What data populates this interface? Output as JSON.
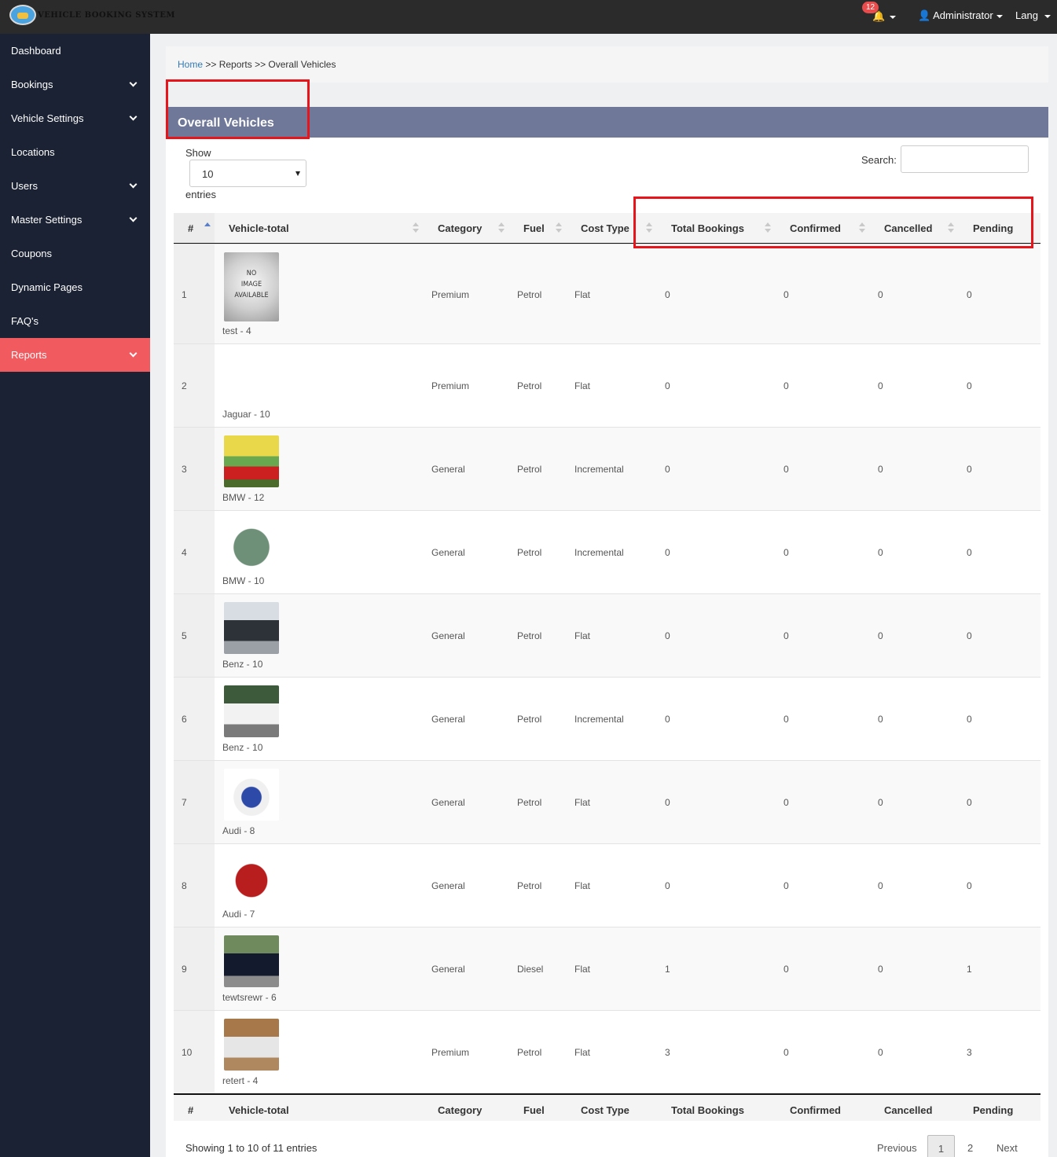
{
  "header": {
    "logo_text": "VEHICLE BOOKING SYSTEM",
    "notification_count": "12",
    "user_label": "Administrator",
    "lang_label": "Lang"
  },
  "sidebar": {
    "items": [
      {
        "label": "Dashboard",
        "has_submenu": false,
        "active": false
      },
      {
        "label": "Bookings",
        "has_submenu": true,
        "active": false
      },
      {
        "label": "Vehicle Settings",
        "has_submenu": true,
        "active": false
      },
      {
        "label": "Locations",
        "has_submenu": false,
        "active": false
      },
      {
        "label": "Users",
        "has_submenu": true,
        "active": false
      },
      {
        "label": "Master Settings",
        "has_submenu": true,
        "active": false
      },
      {
        "label": "Coupons",
        "has_submenu": false,
        "active": false
      },
      {
        "label": "Dynamic Pages",
        "has_submenu": false,
        "active": false
      },
      {
        "label": "FAQ's",
        "has_submenu": false,
        "active": false
      },
      {
        "label": "Reports",
        "has_submenu": true,
        "active": true
      }
    ]
  },
  "breadcrumb": {
    "home": "Home",
    "sep": " >> ",
    "section": "Reports",
    "current": "Overall Vehicles"
  },
  "panel": {
    "title": "Overall Vehicles"
  },
  "controls": {
    "show_label": "Show",
    "page_size": "10",
    "entries_label": "entries",
    "search_label": "Search:",
    "search_value": ""
  },
  "table": {
    "columns": [
      "#",
      "Vehicle-total",
      "Category",
      "Fuel",
      "Cost Type",
      "Total Bookings",
      "Confirmed",
      "Cancelled",
      "Pending"
    ],
    "rows": [
      {
        "n": "1",
        "vehicle": "test - 4",
        "image": "no-image",
        "category": "Premium",
        "fuel": "Petrol",
        "cost_type": "Flat",
        "total": "0",
        "confirmed": "0",
        "cancelled": "0",
        "pending": "0"
      },
      {
        "n": "2",
        "vehicle": "Jaguar - 10",
        "image": "vintage-black-car",
        "category": "Premium",
        "fuel": "Petrol",
        "cost_type": "Flat",
        "total": "0",
        "confirmed": "0",
        "cancelled": "0",
        "pending": "0"
      },
      {
        "n": "3",
        "vehicle": "BMW - 12",
        "image": "red-mini-car",
        "category": "General",
        "fuel": "Petrol",
        "cost_type": "Incremental",
        "total": "0",
        "confirmed": "0",
        "cancelled": "0",
        "pending": "0"
      },
      {
        "n": "4",
        "vehicle": "BMW - 10",
        "image": "green-vintage-car",
        "category": "General",
        "fuel": "Petrol",
        "cost_type": "Incremental",
        "total": "0",
        "confirmed": "0",
        "cancelled": "0",
        "pending": "0"
      },
      {
        "n": "5",
        "vehicle": "Benz - 10",
        "image": "dark-suv",
        "category": "General",
        "fuel": "Petrol",
        "cost_type": "Flat",
        "total": "0",
        "confirmed": "0",
        "cancelled": "0",
        "pending": "0"
      },
      {
        "n": "6",
        "vehicle": "Benz - 10",
        "image": "white-convertible",
        "category": "General",
        "fuel": "Petrol",
        "cost_type": "Incremental",
        "total": "0",
        "confirmed": "0",
        "cancelled": "0",
        "pending": "0"
      },
      {
        "n": "7",
        "vehicle": "Audi - 8",
        "image": "police-van",
        "category": "General",
        "fuel": "Petrol",
        "cost_type": "Flat",
        "total": "0",
        "confirmed": "0",
        "cancelled": "0",
        "pending": "0"
      },
      {
        "n": "8",
        "vehicle": "Audi - 7",
        "image": "red-pickup",
        "category": "General",
        "fuel": "Petrol",
        "cost_type": "Flat",
        "total": "0",
        "confirmed": "0",
        "cancelled": "0",
        "pending": "0"
      },
      {
        "n": "9",
        "vehicle": "tewtsrewr - 6",
        "image": "dark-sports-car",
        "category": "General",
        "fuel": "Diesel",
        "cost_type": "Flat",
        "total": "1",
        "confirmed": "0",
        "cancelled": "0",
        "pending": "1"
      },
      {
        "n": "10",
        "vehicle": "retert - 4",
        "image": "silver-roadster",
        "category": "Premium",
        "fuel": "Petrol",
        "cost_type": "Flat",
        "total": "3",
        "confirmed": "0",
        "cancelled": "0",
        "pending": "3"
      }
    ]
  },
  "footer": {
    "info": "Showing 1 to 10 of 11 entries",
    "previous": "Previous",
    "pages": [
      "1",
      "2"
    ],
    "current_page": "1",
    "next": "Next"
  },
  "colors": {
    "topbar": "#2b2b2b",
    "sidebar": "#1a2233",
    "active_nav": "#f15a5f",
    "panel_header": "#6f7898",
    "highlight_box": "#e8141c",
    "link": "#337ab7"
  },
  "no_image_text": [
    "NO",
    "IMAGE",
    "AVAILABLE"
  ]
}
